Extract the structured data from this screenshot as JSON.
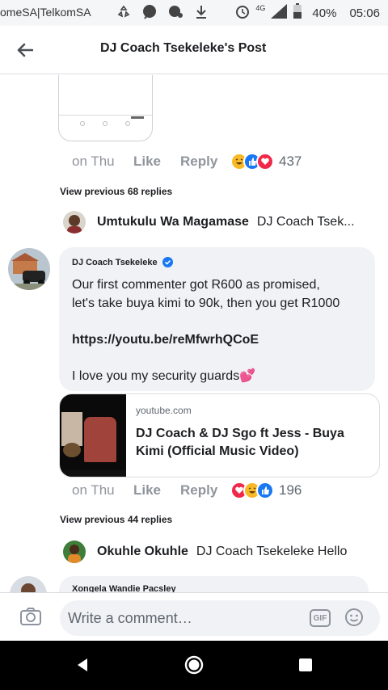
{
  "status_bar": {
    "carrier": "omeSA|TelkomSA",
    "network": "4G",
    "battery": "40%",
    "time": "05:06",
    "icons": [
      "recycle-icon",
      "messenger-icon",
      "chat-icon",
      "download-icon",
      "alarm-icon",
      "signal-icon",
      "battery-icon"
    ]
  },
  "header": {
    "title": "DJ Coach Tsekeleke's Post"
  },
  "comment_top": {
    "time": "on Thu",
    "like_label": "Like",
    "reply_label": "Reply",
    "reaction_count": "437",
    "reactions": [
      "haha",
      "like",
      "love"
    ]
  },
  "view_previous_1": "View previous 68 replies",
  "reply_1": {
    "name": "Umtukulu Wa Magamase",
    "text": "DJ Coach Tsek..."
  },
  "main_comment": {
    "author": "DJ Coach Tsekeleke",
    "verified": true,
    "line1": "Our first commenter got R600 as promised,",
    "line2": "let's take buya kimi to 90k, then you get R1000",
    "link": "https://youtu.be/reMfwrhQCoE",
    "closing": "I love you my security guards💕",
    "time": "on Thu",
    "like_label": "Like",
    "reply_label": "Reply",
    "reaction_count": "196",
    "reactions": [
      "love",
      "haha",
      "like"
    ]
  },
  "link_preview": {
    "domain": "youtube.com",
    "title": "DJ Coach & DJ Sgo ft Jess - Buya Kimi (Official Music Video)"
  },
  "view_previous_2": "View previous 44 replies",
  "reply_2": {
    "name": "Okuhle Okuhle",
    "text": "DJ Coach Tsekeleke Hello"
  },
  "next_comment": {
    "author": "Xongela Wandie Pacsley"
  },
  "composer": {
    "placeholder": "Write a comment…",
    "gif_label": "GIF"
  },
  "colors": {
    "accent": "#1877f2",
    "bubble": "#f0f2f5",
    "meta": "#90949c"
  }
}
